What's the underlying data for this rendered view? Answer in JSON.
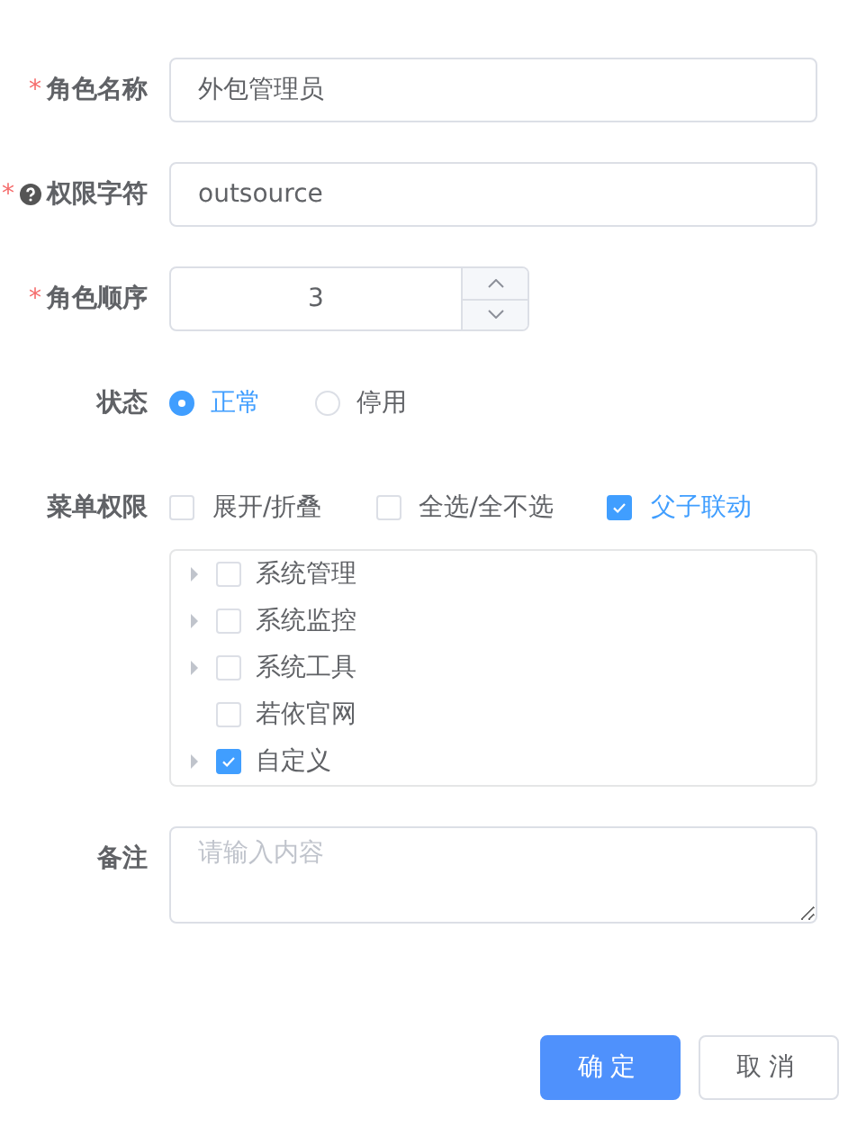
{
  "form": {
    "fields": [
      {
        "kind": "text",
        "label": "角色名称",
        "required_mark": "*",
        "help": false,
        "value": "外包管理员"
      },
      {
        "kind": "text",
        "label": "权限字符",
        "required_mark": "*",
        "help": true,
        "value": "outsource"
      },
      {
        "kind": "number",
        "label": "角色顺序",
        "required_mark": "*",
        "help": false,
        "value": "3"
      },
      {
        "kind": "radio",
        "label": "状态",
        "help": false,
        "options": [
          {
            "label": "正常",
            "selected": true
          },
          {
            "label": "停用",
            "selected": false
          }
        ]
      },
      {
        "kind": "tree",
        "label": "菜单权限",
        "help": false,
        "options": [
          {
            "label": "展开/折叠",
            "checked": false
          },
          {
            "label": "全选/全不选",
            "checked": false
          },
          {
            "label": "父子联动",
            "checked": true
          }
        ],
        "nodes": [
          {
            "label": "系统管理",
            "checked": false,
            "has_children": true
          },
          {
            "label": "系统监控",
            "checked": false,
            "has_children": true
          },
          {
            "label": "系统工具",
            "checked": false,
            "has_children": true
          },
          {
            "label": "若依官网",
            "checked": false,
            "has_children": false
          },
          {
            "label": "自定义",
            "checked": true,
            "has_children": true
          }
        ]
      },
      {
        "kind": "textarea",
        "label": "备注",
        "help": false,
        "placeholder": "请输入内容"
      }
    ]
  },
  "buttons": [
    {
      "label": "确定",
      "kind": "primary"
    },
    {
      "label": "取消",
      "kind": "default"
    }
  ]
}
